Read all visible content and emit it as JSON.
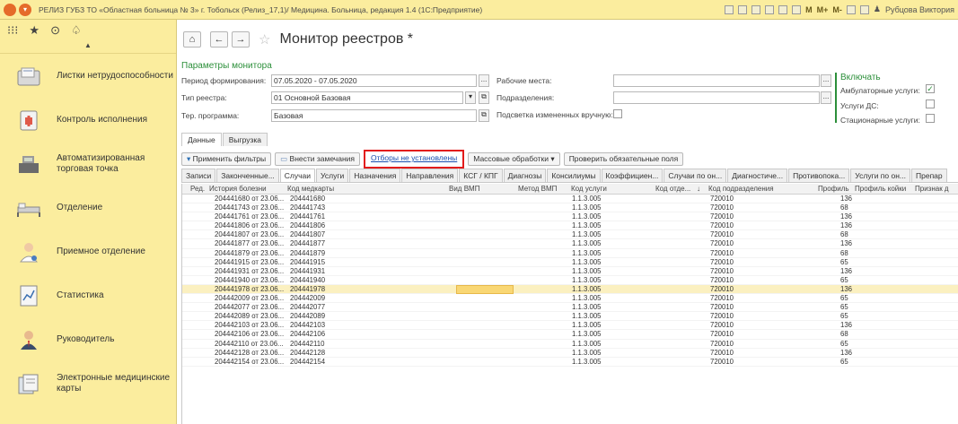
{
  "titlebar": {
    "title": "РЕЛИЗ ГУБЗ ТО «Областная больница № 3» г. Тобольск (Релиз_17,1)/ Медицина. Больница, редакция 1.4 (1С:Предприятие)",
    "user": "Рубцова Виктория",
    "m_labels": [
      "M",
      "M+",
      "M-"
    ]
  },
  "sidebar": {
    "items": [
      {
        "label": "Листки нетрудоспособности",
        "icon": "sick-leave-icon"
      },
      {
        "label": "Контроль исполнения",
        "icon": "control-icon"
      },
      {
        "label": "Автоматизированная торговая точка",
        "icon": "cash-register-icon"
      },
      {
        "label": "Отделение",
        "icon": "ward-bed-icon"
      },
      {
        "label": "Приемное отделение",
        "icon": "doctor-icon"
      },
      {
        "label": "Статистика",
        "icon": "statistics-icon"
      },
      {
        "label": "Руководитель",
        "icon": "manager-icon"
      },
      {
        "label": "Электронные медицинские карты",
        "icon": "medical-cards-icon"
      }
    ]
  },
  "page": {
    "title": "Монитор реестров *"
  },
  "params": {
    "title": "Параметры монитора",
    "period_label": "Период формирования:",
    "period_value": "07.05.2020 - 07.05.2020",
    "type_label": "Тип реестра:",
    "type_value": "01 Основной Базовая",
    "program_label": "Тер. программа:",
    "program_value": "Базовая",
    "workplaces_label": "Рабочие места:",
    "departments_label": "Подразделения:",
    "highlight_label": "Подсветка измененных вручную:",
    "include_title": "Включать",
    "outpatient_label": "Амбулаторные услуги:",
    "ds_label": "Услуги ДС:",
    "inpatient_label": "Стационарные услуги:"
  },
  "tabs": {
    "data": "Данные",
    "upload": "Выгрузка"
  },
  "commands": {
    "apply": "Применить фильтры",
    "remarks": "Внести замечания",
    "filters": "Отборы не установлены",
    "mass": "Массовые обработки",
    "check": "Проверить обязательные поля"
  },
  "subtabs": [
    "Записи",
    "Законченные...",
    "Случаи",
    "Услуги",
    "Назначения",
    "Направления",
    "КСГ / КПГ",
    "Диагнозы",
    "Консилиумы",
    "Коэффициен...",
    "Случаи по он...",
    "Диагностиче...",
    "Противопока...",
    "Услуги по он...",
    "Препар"
  ],
  "columns": [
    "Ред.",
    "История болезни",
    "Код медкарты",
    "Вид ВМП",
    "Метод ВМП",
    "Код услуги",
    "Код отде...",
    "Код подразделения",
    "Профиль",
    "Профиль койки",
    "Признак д"
  ],
  "rows": [
    {
      "history": "204441680 от 23.06...",
      "card": "204441680",
      "service": "1.1.3.005",
      "dept": "720010",
      "profile": "136"
    },
    {
      "history": "204441743 от 23.06...",
      "card": "204441743",
      "service": "1.1.3.005",
      "dept": "720010",
      "profile": "68"
    },
    {
      "history": "204441761 от 23.06...",
      "card": "204441761",
      "service": "1.1.3.005",
      "dept": "720010",
      "profile": "136"
    },
    {
      "history": "204441806 от 23.06...",
      "card": "204441806",
      "service": "1.1.3.005",
      "dept": "720010",
      "profile": "136"
    },
    {
      "history": "204441807 от 23.06...",
      "card": "204441807",
      "service": "1.1.3.005",
      "dept": "720010",
      "profile": "68"
    },
    {
      "history": "204441877 от 23.06...",
      "card": "204441877",
      "service": "1.1.3.005",
      "dept": "720010",
      "profile": "136"
    },
    {
      "history": "204441879 от 23.06...",
      "card": "204441879",
      "service": "1.1.3.005",
      "dept": "720010",
      "profile": "68"
    },
    {
      "history": "204441915 от 23.06...",
      "card": "204441915",
      "service": "1.1.3.005",
      "dept": "720010",
      "profile": "65"
    },
    {
      "history": "204441931 от 23.06...",
      "card": "204441931",
      "service": "1.1.3.005",
      "dept": "720010",
      "profile": "136"
    },
    {
      "history": "204441940 от 23.06...",
      "card": "204441940",
      "service": "1.1.3.005",
      "dept": "720010",
      "profile": "65"
    },
    {
      "history": "204441978 от 23.06...",
      "card": "204441978",
      "service": "1.1.3.005",
      "dept": "720010",
      "profile": "136",
      "selected": true
    },
    {
      "history": "204442009 от 23.06...",
      "card": "204442009",
      "service": "1.1.3.005",
      "dept": "720010",
      "profile": "65"
    },
    {
      "history": "204442077 от 23.06...",
      "card": "204442077",
      "service": "1.1.3.005",
      "dept": "720010",
      "profile": "65"
    },
    {
      "history": "204442089 от 23.06...",
      "card": "204442089",
      "service": "1.1.3.005",
      "dept": "720010",
      "profile": "65"
    },
    {
      "history": "204442103 от 23.06...",
      "card": "204442103",
      "service": "1.1.3.005",
      "dept": "720010",
      "profile": "136"
    },
    {
      "history": "204442106 от 23.06...",
      "card": "204442106",
      "service": "1.1.3.005",
      "dept": "720010",
      "profile": "68"
    },
    {
      "history": "204442110 от 23.06...",
      "card": "204442110",
      "service": "1.1.3.005",
      "dept": "720010",
      "profile": "65"
    },
    {
      "history": "204442128 от 23.06...",
      "card": "204442128",
      "service": "1.1.3.005",
      "dept": "720010",
      "profile": "136"
    },
    {
      "history": "204442154 от 23.06...",
      "card": "204442154",
      "service": "1.1.3.005",
      "dept": "720010",
      "profile": "65"
    }
  ]
}
